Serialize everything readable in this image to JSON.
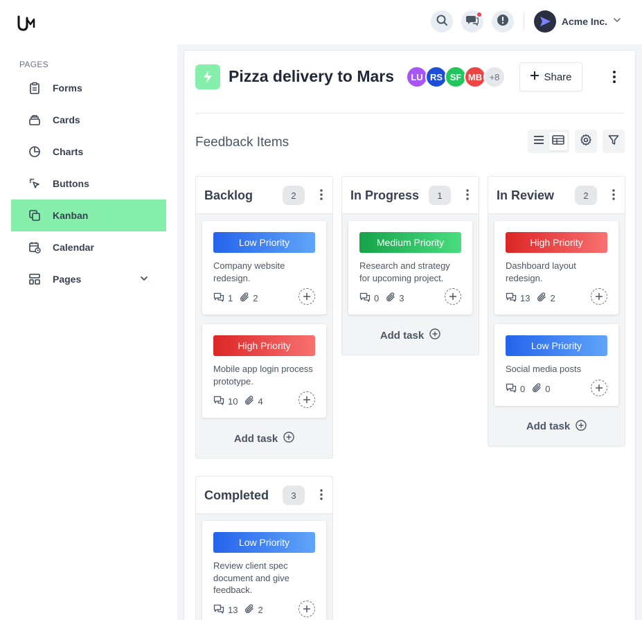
{
  "brand": {
    "logo": "UM"
  },
  "topbar": {
    "account_name": "Acme Inc."
  },
  "sidebar": {
    "heading": "PAGES",
    "items": [
      {
        "label": "Forms",
        "icon": "clipboard-icon"
      },
      {
        "label": "Cards",
        "icon": "cards-icon"
      },
      {
        "label": "Charts",
        "icon": "pie-chart-icon"
      },
      {
        "label": "Buttons",
        "icon": "cursor-click-icon"
      },
      {
        "label": "Kanban",
        "icon": "copy-icon",
        "active": true
      },
      {
        "label": "Calendar",
        "icon": "calendar-icon"
      },
      {
        "label": "Pages",
        "icon": "layout-icon"
      }
    ]
  },
  "project": {
    "title": "Pizza delivery to Mars",
    "members": [
      {
        "initials": "LU",
        "color": "#a855f7"
      },
      {
        "initials": "RS",
        "color": "#1d4ed8"
      },
      {
        "initials": "SF",
        "color": "#22c55e"
      },
      {
        "initials": "MB",
        "color": "#ef4444"
      }
    ],
    "more_members": "+8",
    "share_label": "Share"
  },
  "board": {
    "section_title": "Feedback Items",
    "add_task_label": "Add task",
    "columns": [
      {
        "title": "Backlog",
        "count": "2",
        "tasks": [
          {
            "priority": "Low Priority",
            "level": "low",
            "text": "Company website redesign.",
            "comments": "1",
            "attachments": "2"
          },
          {
            "priority": "High Priority",
            "level": "high",
            "text": "Mobile app login process prototype.",
            "comments": "10",
            "attachments": "4"
          }
        ]
      },
      {
        "title": "In Progress",
        "count": "1",
        "tasks": [
          {
            "priority": "Medium Priority",
            "level": "medium",
            "text": "Research and strategy for upcoming project.",
            "comments": "0",
            "attachments": "3"
          }
        ]
      },
      {
        "title": "In Review",
        "count": "2",
        "tasks": [
          {
            "priority": "High Priority",
            "level": "high",
            "text": "Dashboard layout redesign.",
            "comments": "13",
            "attachments": "2"
          },
          {
            "priority": "Low Priority",
            "level": "low",
            "text": "Social media posts",
            "comments": "0",
            "attachments": "0"
          }
        ]
      },
      {
        "title": "Completed",
        "count": "3",
        "tasks": [
          {
            "priority": "Low Priority",
            "level": "low",
            "text": "Review client spec document and give feedback.",
            "comments": "13",
            "attachments": "2"
          }
        ]
      }
    ]
  }
}
